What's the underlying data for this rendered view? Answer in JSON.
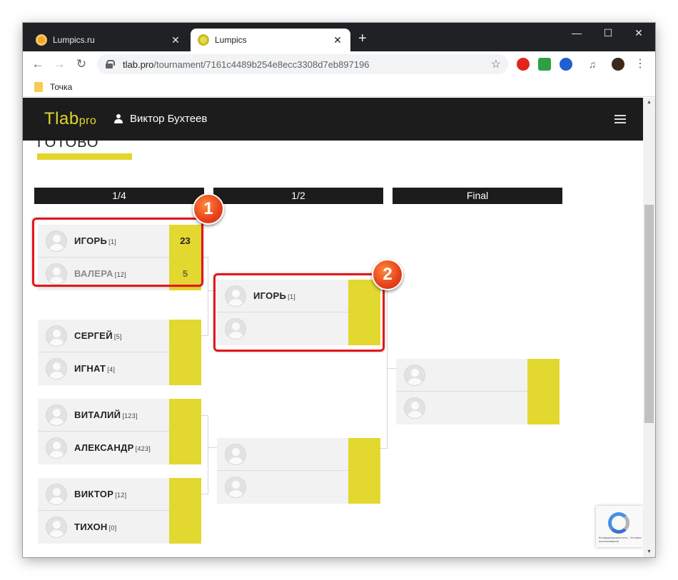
{
  "browser": {
    "tabs": [
      {
        "title": "Lumpics.ru",
        "active": false,
        "favicon": "orange-circle"
      },
      {
        "title": "Lumpics",
        "active": true,
        "favicon": "heart-yellow"
      }
    ],
    "new_tab_label": "+",
    "window_controls": {
      "minimize": "—",
      "maximize": "☐",
      "close": "✕"
    },
    "url_host": "tlab.pro",
    "url_path": "/tournament/7161c4489b254e8ecc3308d7eb897196",
    "bookmark": "Точка"
  },
  "site": {
    "logo_main": "Tlab",
    "logo_sub": "pro",
    "user_name": "Виктор Бухтеев",
    "section_title": "ГОТОВО"
  },
  "rounds": [
    "1/4",
    "1/2",
    "Final"
  ],
  "quarterfinals": [
    {
      "p1": {
        "name": "ИГОРЬ",
        "seed": "[1]",
        "score": "23"
      },
      "p2": {
        "name": "ВАЛЕРА",
        "seed": "[12]",
        "score": "5"
      }
    },
    {
      "p1": {
        "name": "СЕРГЕЙ",
        "seed": "[5]",
        "score": ""
      },
      "p2": {
        "name": "ИГНАТ",
        "seed": "[4]",
        "score": ""
      }
    },
    {
      "p1": {
        "name": "ВИТАЛИЙ",
        "seed": "[123]",
        "score": ""
      },
      "p2": {
        "name": "АЛЕКСАНДР",
        "seed": "[423]",
        "score": ""
      }
    },
    {
      "p1": {
        "name": "ВИКТОР",
        "seed": "[12]",
        "score": ""
      },
      "p2": {
        "name": "ТИХОН",
        "seed": "[0]",
        "score": ""
      }
    }
  ],
  "semifinals": [
    {
      "p1": {
        "name": "ИГОРЬ",
        "seed": "[1]",
        "score": ""
      },
      "p2": {
        "name": "",
        "seed": "",
        "score": ""
      }
    },
    {
      "p1": {
        "name": "",
        "seed": "",
        "score": ""
      },
      "p2": {
        "name": "",
        "seed": "",
        "score": ""
      }
    }
  ],
  "final": {
    "p1": {
      "name": "",
      "seed": "",
      "score": ""
    },
    "p2": {
      "name": "",
      "seed": "",
      "score": ""
    }
  },
  "annotations": [
    "1",
    "2"
  ],
  "recaptcha_text": "Конфиденциальность - Условия использования",
  "colors": {
    "accent": "#e2d830",
    "header": "#1c1c1c",
    "highlight": "#e3161b"
  }
}
